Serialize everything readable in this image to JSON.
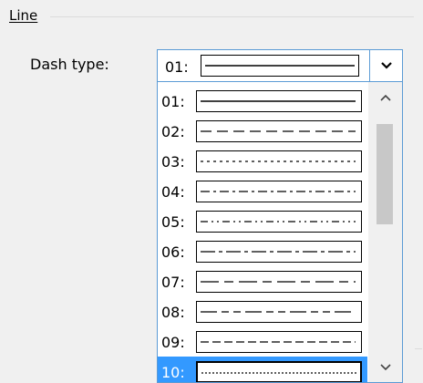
{
  "group": {
    "title": "Line"
  },
  "dash_type": {
    "label": "Dash type:",
    "selected": {
      "number": "01:",
      "pattern": "solid"
    },
    "items": [
      {
        "number": "01:",
        "pattern": "solid",
        "dash": ""
      },
      {
        "number": "02:",
        "pattern": "dash",
        "dash": "12 6"
      },
      {
        "number": "03:",
        "pattern": "dot",
        "dash": "3 4"
      },
      {
        "number": "04:",
        "pattern": "dash-dot",
        "dash": "10 4 3 4"
      },
      {
        "number": "05:",
        "pattern": "dash-dot-dot",
        "dash": "8 4 2 4 2 4"
      },
      {
        "number": "06:",
        "pattern": "long-dash-dot",
        "dash": "16 4 4 4"
      },
      {
        "number": "07:",
        "pattern": "long-dash-short-dash",
        "dash": "20 6 10 6"
      },
      {
        "number": "08:",
        "pattern": "long-dash-short-dash-short-dash",
        "dash": "18 5 8 5 8 5"
      },
      {
        "number": "09:",
        "pattern": "short-dash",
        "dash": "9 4"
      },
      {
        "number": "10:",
        "pattern": "fine-dot",
        "dash": "2 2",
        "selected": true
      }
    ]
  },
  "icons": {
    "dropdown": "chevron-down-icon",
    "scroll_up": "chevron-up-icon",
    "scroll_down": "chevron-down-icon"
  },
  "colors": {
    "accent_border": "#5b9bd5",
    "selection": "#3399ff"
  }
}
